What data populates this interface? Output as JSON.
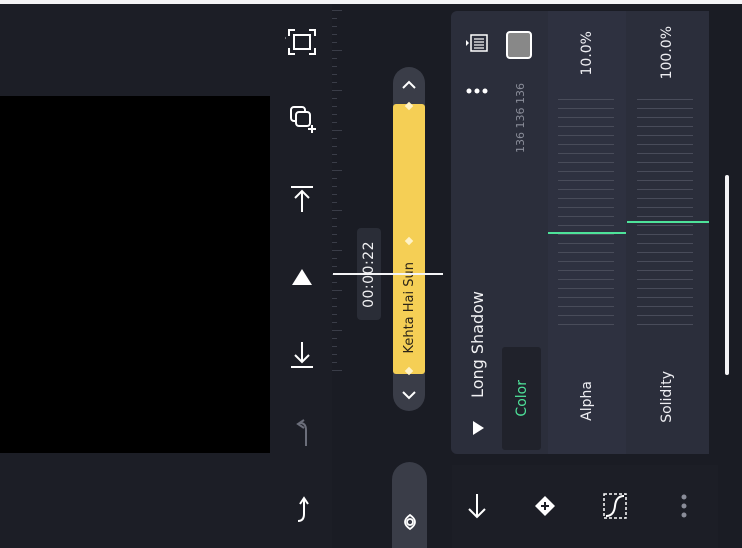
{
  "timeline": {
    "current_time": "00:00:22",
    "clip_title": "Kehta Hai Sun"
  },
  "panel": {
    "section_title": "Long Shadow",
    "color_tab": "Color",
    "alpha_label": "Alpha",
    "solidity_label": "Solidity",
    "alpha_value": "10.0%",
    "solidity_value": "100.0%",
    "rgb_text": "136 136 136",
    "swatch_color": "#888888",
    "alpha_fraction": 0.1,
    "solidity_fraction": 1.0
  },
  "colors": {
    "accent_green": "#4ee39a",
    "clip_yellow": "#f5cf55"
  },
  "icons": {
    "tools": [
      "fullscreen-icon",
      "duplicate-icon",
      "align-top-icon",
      "play-icon",
      "align-bottom-icon",
      "undo-icon",
      "redo-icon"
    ],
    "bottom": [
      "arrow-down-icon",
      "keyframe-add-icon",
      "crop-icon",
      "more-icon"
    ]
  }
}
